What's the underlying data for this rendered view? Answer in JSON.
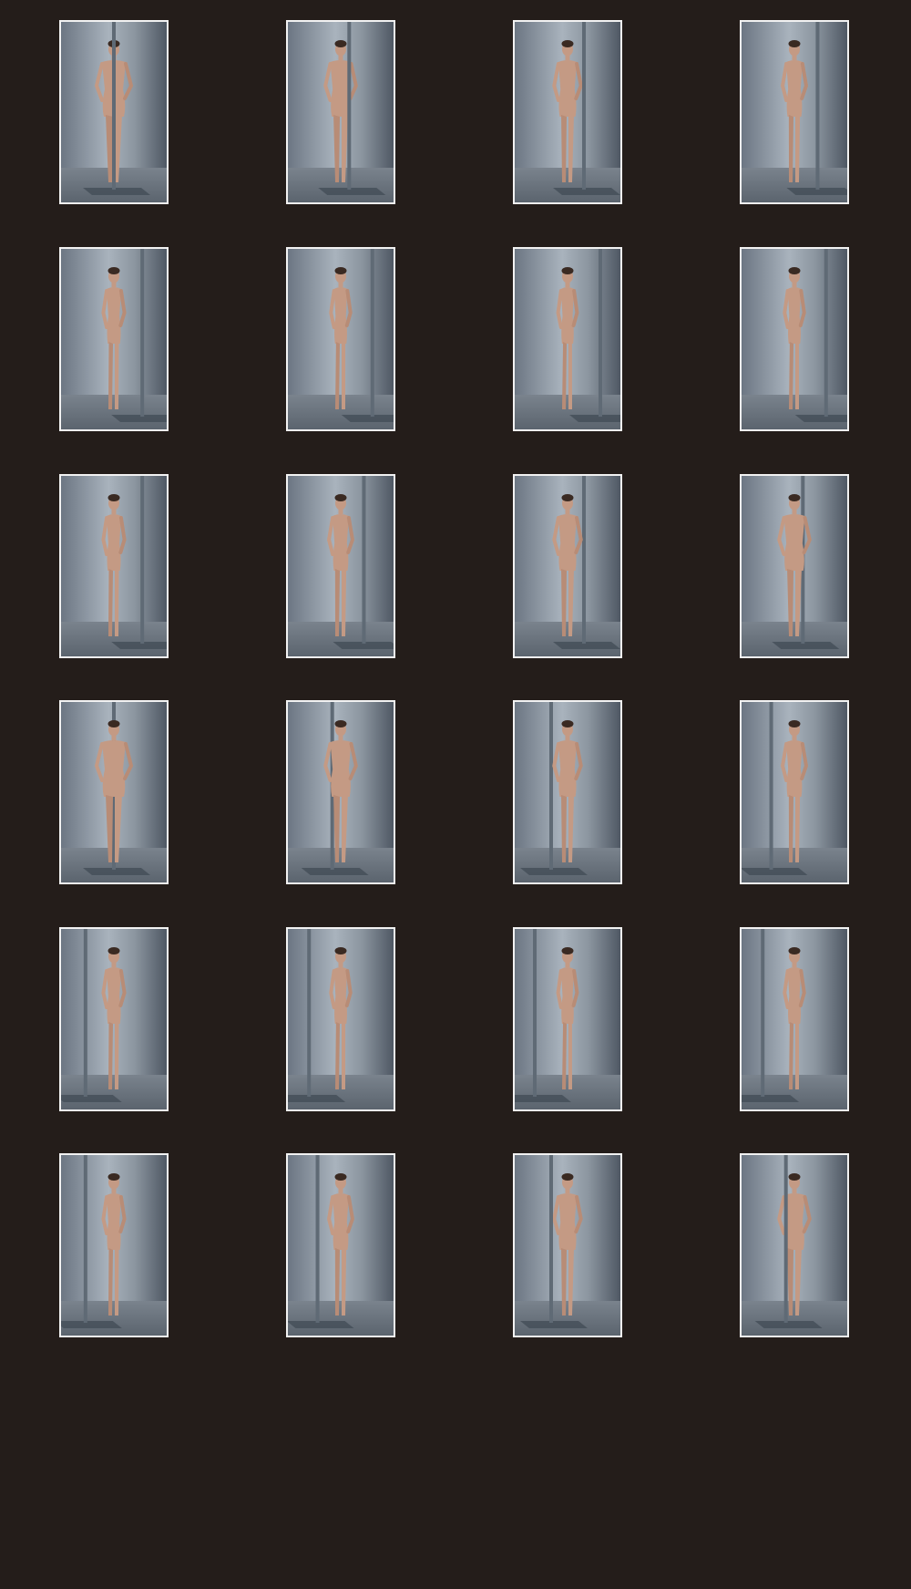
{
  "gallery": {
    "rows": 6,
    "columns": 4,
    "thumbnail_count": 24,
    "colors": {
      "page_background": "#241d1a",
      "thumbnail_border": "#f2f2f2",
      "backdrop": "#9aa4ae",
      "pole": "#5f6a75",
      "skin": "#c49a84"
    },
    "thumbnails": [
      {
        "pose": "front",
        "turn": 0
      },
      {
        "pose": "front",
        "turn": 15
      },
      {
        "pose": "three-quarter-left",
        "turn": 30
      },
      {
        "pose": "three-quarter-left",
        "turn": 45
      },
      {
        "pose": "side-left",
        "turn": 60
      },
      {
        "pose": "side-left",
        "turn": 75
      },
      {
        "pose": "side-left",
        "turn": 90
      },
      {
        "pose": "three-quarter-back",
        "turn": 105
      },
      {
        "pose": "back",
        "turn": 120
      },
      {
        "pose": "back",
        "turn": 135
      },
      {
        "pose": "back",
        "turn": 150
      },
      {
        "pose": "back",
        "turn": 165
      },
      {
        "pose": "back",
        "turn": 180
      },
      {
        "pose": "back",
        "turn": 195
      },
      {
        "pose": "three-quarter-back",
        "turn": 210
      },
      {
        "pose": "side-right",
        "turn": 225
      },
      {
        "pose": "side-right",
        "turn": 240
      },
      {
        "pose": "side-right",
        "turn": 255
      },
      {
        "pose": "side-right",
        "turn": 270
      },
      {
        "pose": "three-quarter-right",
        "turn": 285
      },
      {
        "pose": "three-quarter-right",
        "turn": 300
      },
      {
        "pose": "three-quarter-right",
        "turn": 315
      },
      {
        "pose": "front",
        "turn": 330
      },
      {
        "pose": "front",
        "turn": 345
      }
    ]
  }
}
